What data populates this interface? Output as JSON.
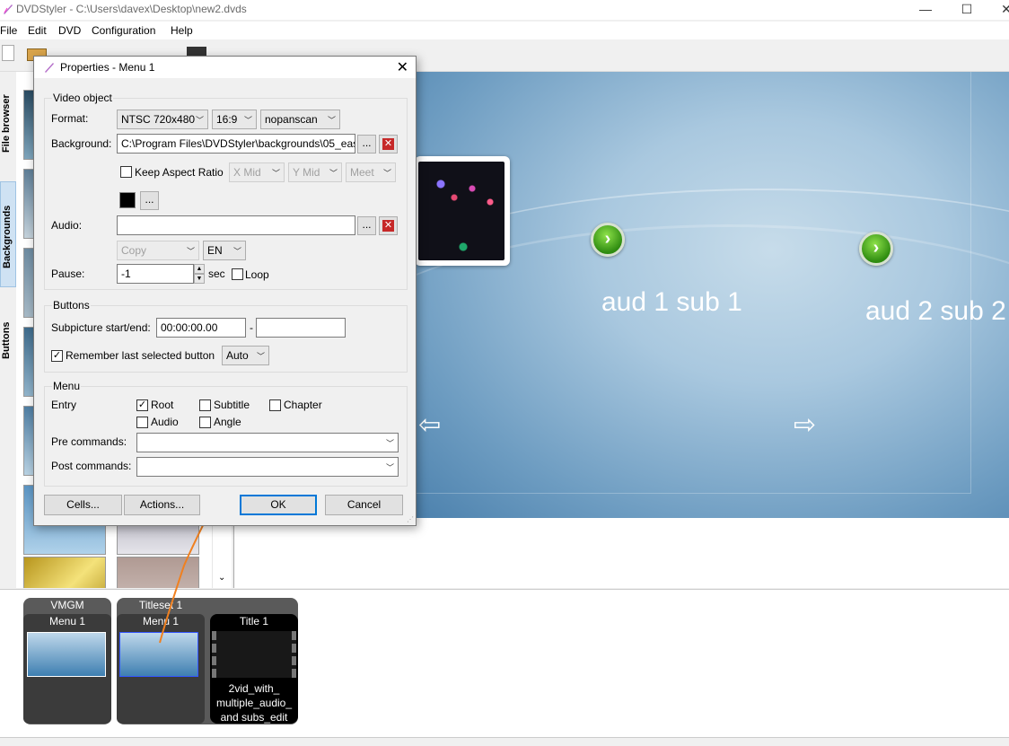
{
  "window": {
    "title": "DVDStyler - C:\\Users\\davex\\Desktop\\new2.dvds"
  },
  "menubar": [
    "File",
    "Edit",
    "DVD",
    "Configuration",
    "Help"
  ],
  "sidetabs": [
    "File browser",
    "Backgrounds",
    "Buttons"
  ],
  "canvas": {
    "label1": "aud 1 sub 1",
    "label2": "aud 2 sub 2",
    "next_icon": "chevron-right-icon",
    "left_arrow": "⇦",
    "right_arrow": "⇨"
  },
  "titleset": {
    "vmgm_label": "VMGM",
    "vmgm_menu": "Menu 1",
    "titleset_label": "Titleset 1",
    "titleset_menu": "Menu 1",
    "title_label": "Title 1",
    "title_name": "2vid_with_ multiple_audio_ and subs_edit"
  },
  "dialog": {
    "title": "Properties - Menu 1",
    "video_object": {
      "group_title": "Video object",
      "format_label": "Format:",
      "format_value": "NTSC 720x480",
      "aspect_value": "16:9",
      "pan_value": "nopanscan",
      "background_label": "Background:",
      "background_value": "C:\\Program Files\\DVDStyler\\backgrounds\\05_eas",
      "keep_aspect_label": "Keep Aspect Ratio",
      "xmid": "X Mid",
      "ymid": "Y Mid",
      "meet": "Meet",
      "browse": "...",
      "audio_label": "Audio:",
      "audio_value": "",
      "copy_value": "Copy",
      "lang_value": "EN",
      "pause_label": "Pause:",
      "pause_value": "-1",
      "sec_label": "sec",
      "loop_label": "Loop"
    },
    "buttons_group": {
      "group_title": "Buttons",
      "subpicture_label": "Subpicture start/end:",
      "start_value": "00:00:00.00",
      "dash": "-",
      "end_value": "",
      "remember_label": "Remember last selected button",
      "remember_checked": true,
      "auto_value": "Auto"
    },
    "menu_group": {
      "group_title": "Menu",
      "entry_label": "Entry",
      "root_label": "Root",
      "subtitle_label": "Subtitle",
      "chapter_label": "Chapter",
      "audio_label": "Audio",
      "angle_label": "Angle",
      "root_checked": true,
      "pre_label": "Pre commands:",
      "post_label": "Post commands:"
    },
    "buttons": {
      "cells": "Cells...",
      "actions": "Actions...",
      "ok": "OK",
      "cancel": "Cancel"
    }
  }
}
